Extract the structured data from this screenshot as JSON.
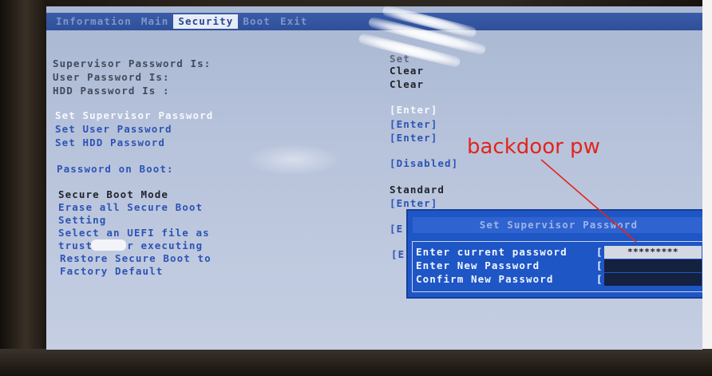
{
  "menu": {
    "tabs": [
      {
        "label": "Information"
      },
      {
        "label": "Main"
      },
      {
        "label": "Security"
      },
      {
        "label": "Boot"
      },
      {
        "label": "Exit"
      }
    ],
    "active_tab": "Security"
  },
  "status": {
    "supervisor_label": "Supervisor Password Is:",
    "supervisor_value": "Set",
    "user_label": "User Password Is:",
    "user_value": "Clear",
    "hdd_label": "HDD Password Is :",
    "hdd_value": "Clear"
  },
  "items": {
    "set_supervisor": {
      "label": "Set Supervisor Password",
      "value": "[Enter]"
    },
    "set_user": {
      "label": "Set User Password",
      "value": "[Enter]"
    },
    "set_hdd": {
      "label": "Set HDD Password",
      "value": "[Enter]"
    },
    "password_on_boot": {
      "label": "Password on Boot:",
      "value": "[Disabled]"
    },
    "secure_boot_mode": {
      "label": "Secure Boot Mode",
      "value": "Standard"
    },
    "erase_secure_boot": {
      "label_1": "Erase all Secure Boot",
      "label_2": "Setting",
      "value": "[Enter]"
    },
    "select_uefi": {
      "label_1": "Select an UEFI file as",
      "label_2": "trusted for executing",
      "value": "[E"
    },
    "restore_secure_boot": {
      "label_1": "Restore Secure Boot to",
      "label_2": "Factory Default",
      "value": "[E"
    }
  },
  "dialog": {
    "title": "Set Supervisor Password",
    "current_label": "Enter current password",
    "current_value": "*********",
    "new_label": "Enter New Password",
    "confirm_label": "Confirm New Password",
    "bracket_open": "[",
    "bracket_close": "]"
  },
  "annotation": {
    "text": "backdoor pw",
    "color": "#e2251c"
  },
  "colors": {
    "screen_bg": "#b7c3db",
    "menubar": "#2f4f9a",
    "dialog_bg": "#1e56c6",
    "highlight_text": "#f6f8ff",
    "link_text": "#2d54b5"
  }
}
